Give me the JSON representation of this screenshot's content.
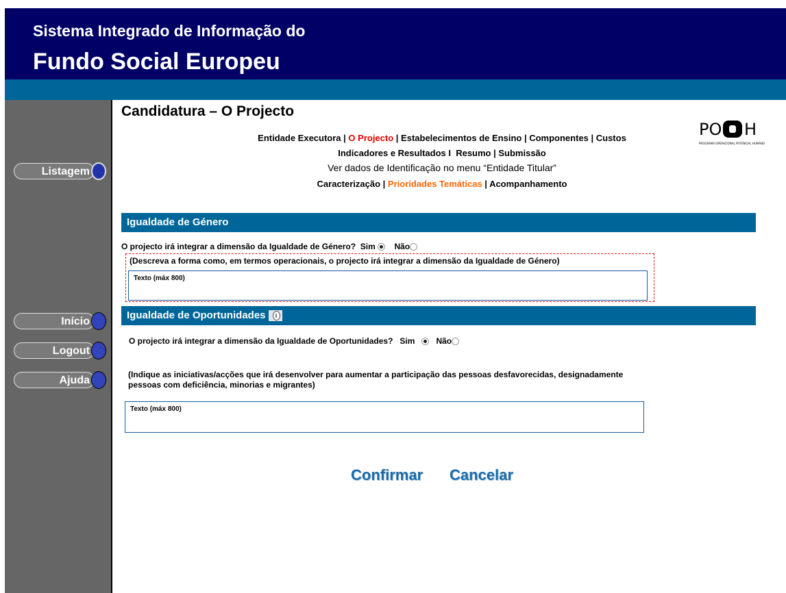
{
  "header": {
    "subtitle": "Sistema Integrado de Informação do",
    "title": "Fundo Social Europeu"
  },
  "sidebar": {
    "listagem": "Listagem",
    "inicio": "Início",
    "logout": "Logout",
    "ajuda": "Ajuda"
  },
  "page": {
    "title": "Candidatura – O Projecto"
  },
  "nav": {
    "line1": {
      "entidade": "Entidade Executora",
      "sep1": " | ",
      "projecto": "O Projecto",
      "sep2": " | ",
      "estabelecimentos": "Estabelecimentos de Ensino",
      "sep3": " | ",
      "componentes": "Componentes",
      "sep4": " | ",
      "custos": "Custos"
    },
    "line2": {
      "indicadores": "Indicadores e Resultados",
      "sep1": " I  ",
      "resumo": "Resumo",
      "sep2": " | ",
      "submissao": "Submissão"
    },
    "line3": "Ver dados de Identificação no menu “Entidade Titular”",
    "line4": {
      "caracterizacao": "Caracterização",
      "sep1": " | ",
      "prioridades": "Prioridades Temáticas",
      "sep2": " | ",
      "acompanhamento": "Acompanhamento"
    }
  },
  "logo": {
    "text": "POPH",
    "caption": "PROGRAMA OPERACIONAL POTENCIAL HUMANO"
  },
  "genero": {
    "heading": "Igualdade de Género",
    "question": "O projecto irá integrar a dimensão da Igualdade de Género?",
    "sim": "Sim",
    "nao": "Não",
    "selected": "Sim",
    "instruction": "(Descreva a forma como, em termos operacionais, o projecto irá integrar a dimensão da Igualdade de Género)",
    "textbox_label": "Texto (máx 800)"
  },
  "oportunidades": {
    "heading": "Igualdade de Oportunidades",
    "question": "O projecto irá integrar a dimensão da Igualdade de Oportunidades?",
    "sim": "Sim",
    "nao": "Não",
    "selected": "Sim",
    "instruction_line1": "(Indique as iniciativas/acções que irá desenvolver para aumentar a participação das pessoas desfavorecidas, designadamente",
    "instruction_line2": "pessoas com deficiência, minorias e migrantes)",
    "textbox_label": "Texto (máx 800)"
  },
  "actions": {
    "confirmar": "Confirmar",
    "cancelar": "Cancelar"
  },
  "colors": {
    "header": "#000066",
    "bar": "#006699",
    "sidebar": "#666666",
    "active_link": "#e00000",
    "subnav_active": "#ff6600"
  }
}
